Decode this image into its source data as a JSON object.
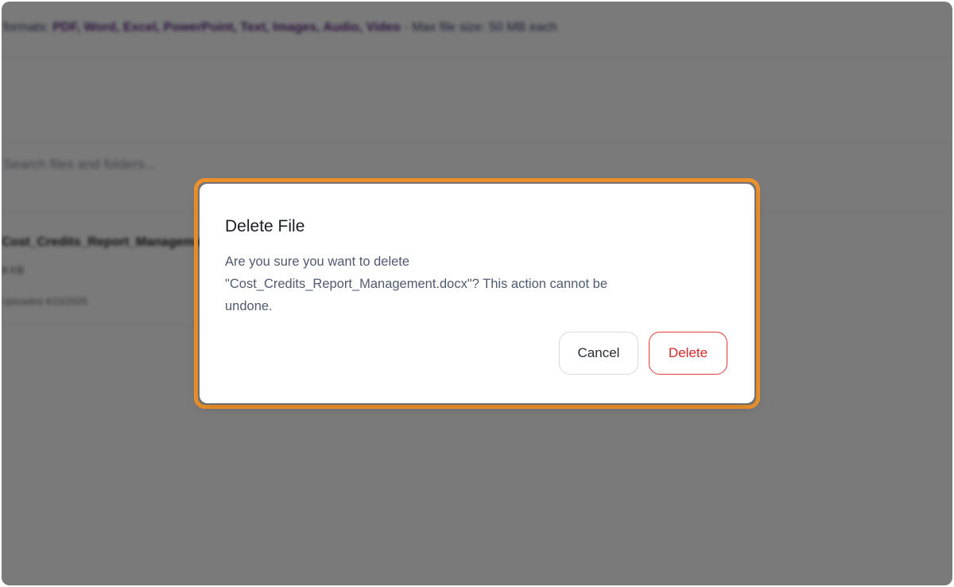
{
  "background": {
    "supported_formats_prefix": "formats: ",
    "supported_formats": "PDF, Word, Excel, PowerPoint, Text, Images, Audio, Video",
    "max_size_text": " · Max file size: 50 MB each",
    "search_placeholder": "Search files and folders...",
    "file_name": "Cost_Credits_Report_Management.docx",
    "file_size": "8 KB",
    "file_date": "Uploaded 4/15/2025"
  },
  "dialog": {
    "title": "Delete File",
    "message_line1": "Are you sure you want to delete",
    "message_line2": "\"Cost_Credits_Report_Management.docx\"? This action cannot be",
    "message_line3": "undone.",
    "cancel_label": "Cancel",
    "delete_label": "Delete"
  },
  "colors": {
    "highlight": "#f0932b",
    "delete_accent": "#d92828",
    "overlay": "rgba(0,0,0,0.5)"
  }
}
